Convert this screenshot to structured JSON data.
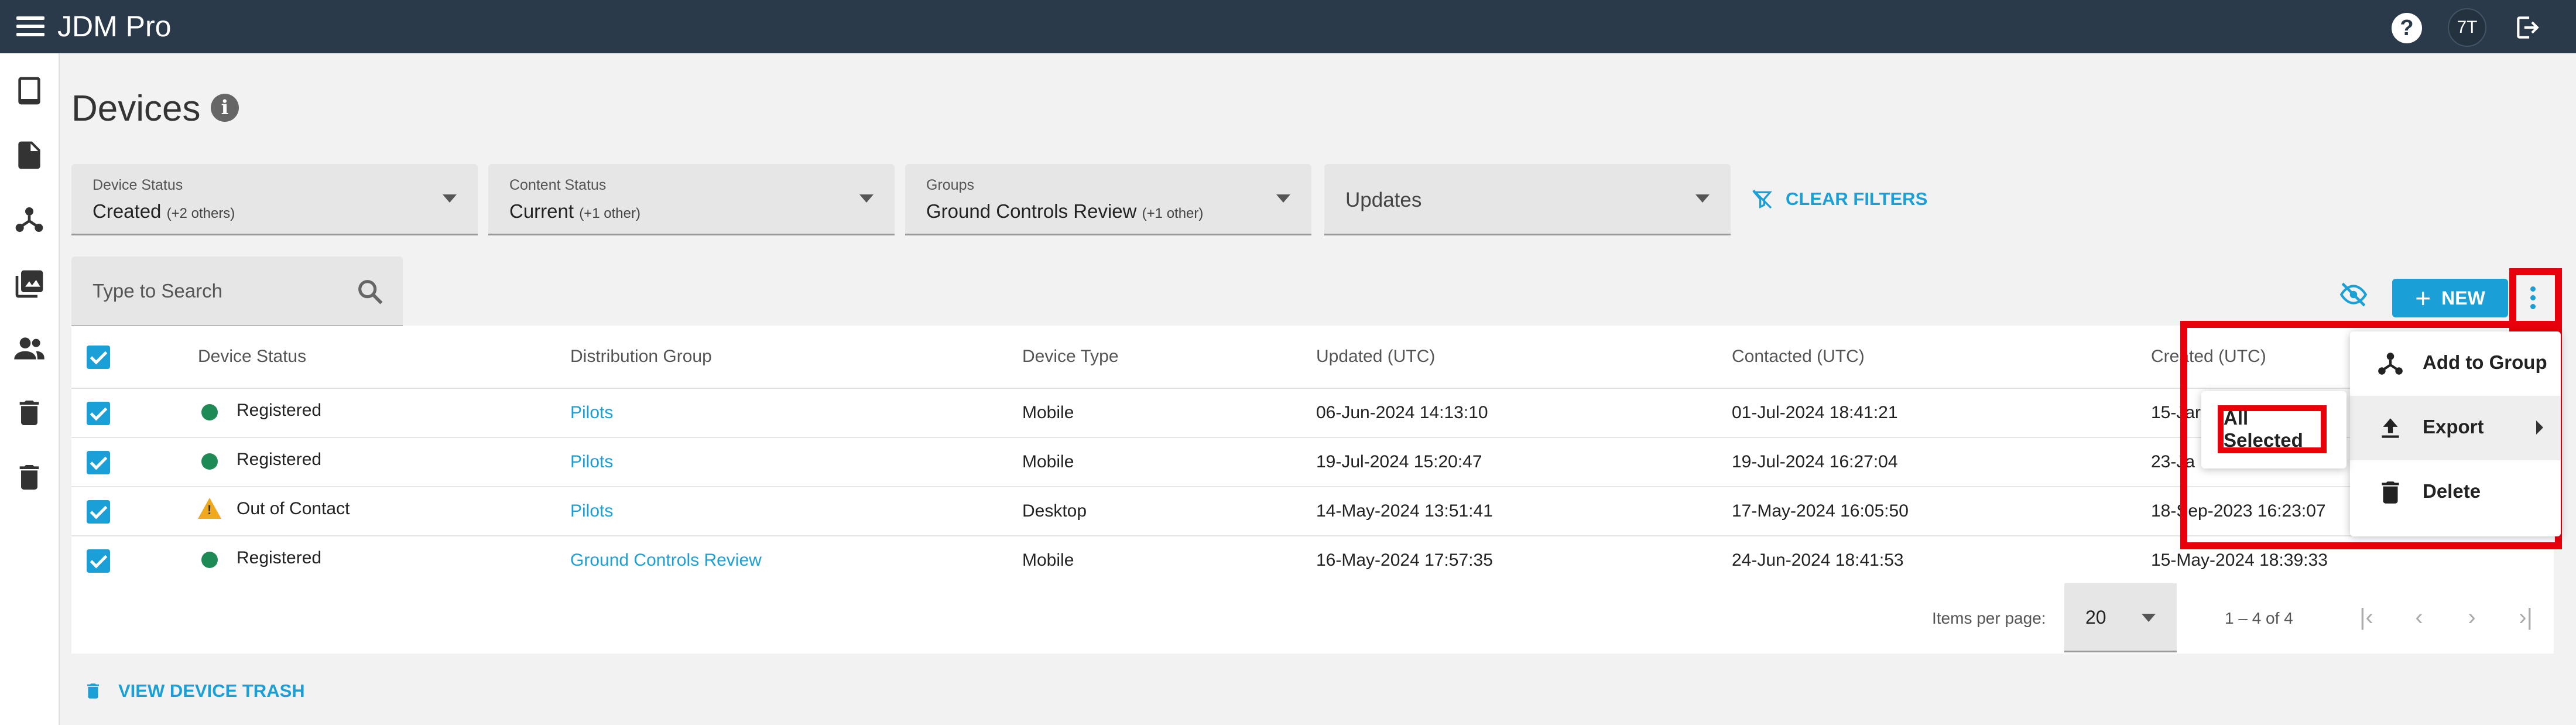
{
  "app": {
    "title": "JDM Pro",
    "avatar": "7T",
    "help": "?"
  },
  "page": {
    "title": "Devices",
    "info": "i"
  },
  "filters": [
    {
      "label": "Device Status",
      "value": "Created",
      "extra": "(+2 others)"
    },
    {
      "label": "Content Status",
      "value": "Current",
      "extra": "(+1 other)"
    },
    {
      "label": "Groups",
      "value": "Ground Controls Review",
      "extra": "(+1 other)"
    },
    {
      "label": "",
      "value": "Updates",
      "extra": ""
    }
  ],
  "clear_filters": "CLEAR FILTERS",
  "search": {
    "placeholder": "Type to Search"
  },
  "toolbar": {
    "new_label": "NEW"
  },
  "table": {
    "headers": [
      "Device Status",
      "Distribution Group",
      "Device Type",
      "Updated (UTC)",
      "Contacted (UTC)",
      "Created (UTC)"
    ],
    "rows": [
      {
        "status": "Registered",
        "status_type": "ok",
        "group": "Pilots",
        "type": "Mobile",
        "updated": "06-Jun-2024 14:13:10",
        "contacted": "01-Jul-2024 18:41:21",
        "created": "15-Jar"
      },
      {
        "status": "Registered",
        "status_type": "ok",
        "group": "Pilots",
        "type": "Mobile",
        "updated": "19-Jul-2024 15:20:47",
        "contacted": "19-Jul-2024 16:27:04",
        "created": "23-Ja"
      },
      {
        "status": "Out of Contact",
        "status_type": "warning",
        "group": "Pilots",
        "type": "Desktop",
        "updated": "14-May-2024 13:51:41",
        "contacted": "17-May-2024 16:05:50",
        "created": "18-Sep-2023 16:23:07"
      },
      {
        "status": "Registered",
        "status_type": "ok",
        "group": "Ground Controls Review",
        "type": "Mobile",
        "updated": "16-May-2024 17:57:35",
        "contacted": "24-Jun-2024 18:41:53",
        "created": "15-May-2024 18:39:33"
      }
    ]
  },
  "pagination": {
    "label": "Items per page:",
    "per_page": "20",
    "range": "1 – 4 of 4"
  },
  "trash_link": "VIEW DEVICE TRASH",
  "menu": {
    "items": [
      {
        "label": "Add to Group"
      },
      {
        "label": "Export"
      },
      {
        "label": "Delete"
      }
    ],
    "submenu": {
      "label": "All Selected"
    }
  },
  "colors": {
    "accent": "#1a9fd6",
    "topbar": "#2b3a4a",
    "ok": "#1e8a55",
    "warning": "#f0a81c",
    "highlight": "#e8000b"
  }
}
